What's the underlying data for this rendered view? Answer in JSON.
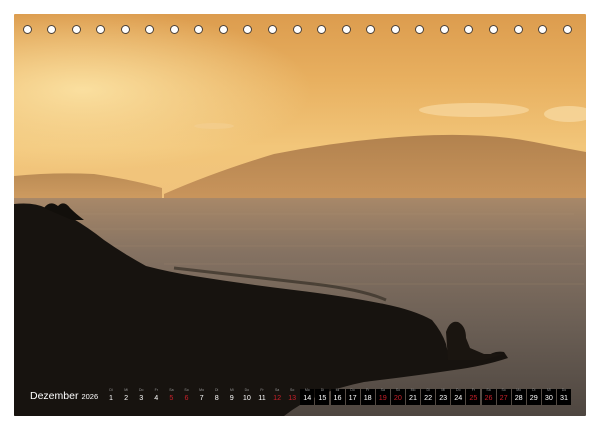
{
  "calendar": {
    "month": "Dezember",
    "year": "2026",
    "weekday_abbr": [
      "Di",
      "Mi",
      "Do",
      "Fr",
      "Sa",
      "So",
      "Mo"
    ],
    "days": [
      {
        "num": "1",
        "weekend": false
      },
      {
        "num": "2",
        "weekend": false
      },
      {
        "num": "3",
        "weekend": false
      },
      {
        "num": "4",
        "weekend": false
      },
      {
        "num": "5",
        "weekend": true
      },
      {
        "num": "6",
        "weekend": true
      },
      {
        "num": "7",
        "weekend": false
      },
      {
        "num": "8",
        "weekend": false
      },
      {
        "num": "9",
        "weekend": false
      },
      {
        "num": "10",
        "weekend": false
      },
      {
        "num": "11",
        "weekend": false
      },
      {
        "num": "12",
        "weekend": true
      },
      {
        "num": "13",
        "weekend": true
      },
      {
        "num": "14",
        "weekend": false
      },
      {
        "num": "15",
        "weekend": false
      },
      {
        "num": "16",
        "weekend": false
      },
      {
        "num": "17",
        "weekend": false
      },
      {
        "num": "18",
        "weekend": false
      },
      {
        "num": "19",
        "weekend": true
      },
      {
        "num": "20",
        "weekend": true
      },
      {
        "num": "21",
        "weekend": false
      },
      {
        "num": "22",
        "weekend": false
      },
      {
        "num": "23",
        "weekend": false
      },
      {
        "num": "24",
        "weekend": false
      },
      {
        "num": "25",
        "weekend": true
      },
      {
        "num": "26",
        "weekend": true
      },
      {
        "num": "27",
        "weekend": true
      },
      {
        "num": "28",
        "weekend": false
      },
      {
        "num": "29",
        "weekend": false
      },
      {
        "num": "30",
        "weekend": false
      },
      {
        "num": "31",
        "weekend": false
      }
    ],
    "colors": {
      "weekend": "#c8202a",
      "text": "#ffffff",
      "box": "#000000"
    }
  },
  "binding": {
    "hole_count": 23
  },
  "photo": {
    "subject": "coastal-sunset-silhouette",
    "palette": [
      "#e0a34e",
      "#f6d08a",
      "#b8875a",
      "#6d6055",
      "#17130f"
    ]
  }
}
